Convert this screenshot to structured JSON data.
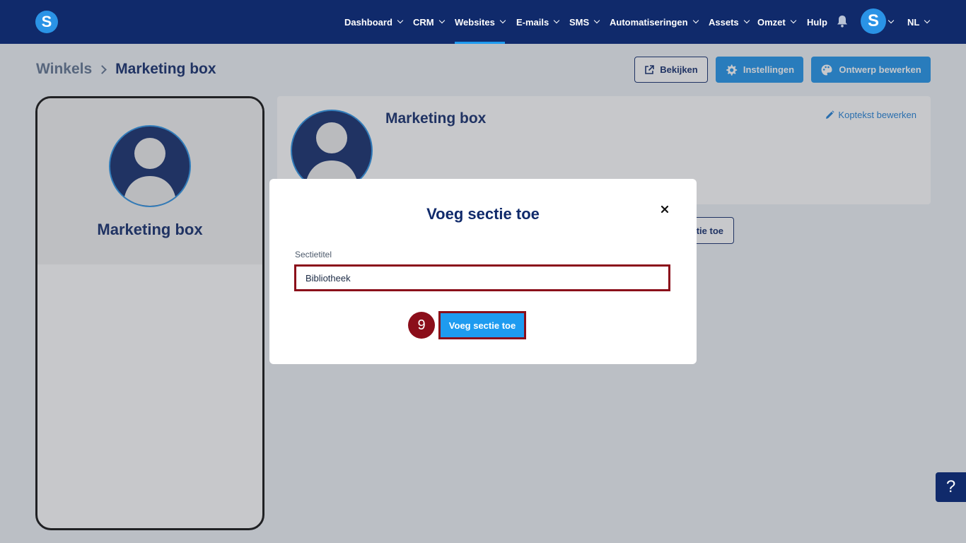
{
  "topbar": {
    "logo_letter": "S",
    "nav": [
      {
        "label": "Dashboard"
      },
      {
        "label": "CRM"
      },
      {
        "label": "Websites"
      },
      {
        "label": "E-mails"
      },
      {
        "label": "SMS"
      },
      {
        "label": "Automatiseringen"
      },
      {
        "label": "Assets"
      },
      {
        "label": "Omzet"
      },
      {
        "label": "Hulp"
      }
    ],
    "active_nav": "Websites",
    "avatar_letter": "S",
    "language": "NL"
  },
  "breadcrumb": {
    "parent": "Winkels",
    "current": "Marketing box"
  },
  "actions": {
    "view_label": "Bekijken",
    "settings_label": "Instellingen",
    "design_label": "Ontwerp bewerken"
  },
  "phone_preview": {
    "title": "Marketing box"
  },
  "card": {
    "title": "Marketing box",
    "edit_header_label": "Koptekst bewerken",
    "add_section_partial": "tie toe"
  },
  "modal": {
    "title": "Voeg sectie toe",
    "field_label": "Sectietitel",
    "field_value": "Bibliotheek",
    "submit_label": "Voeg sectie toe",
    "step_number": "9"
  },
  "help": {
    "label": "?"
  },
  "colors": {
    "navy": "#102a6b",
    "accent_blue": "#1e93ea",
    "highlight_red": "#8b0e1a"
  }
}
